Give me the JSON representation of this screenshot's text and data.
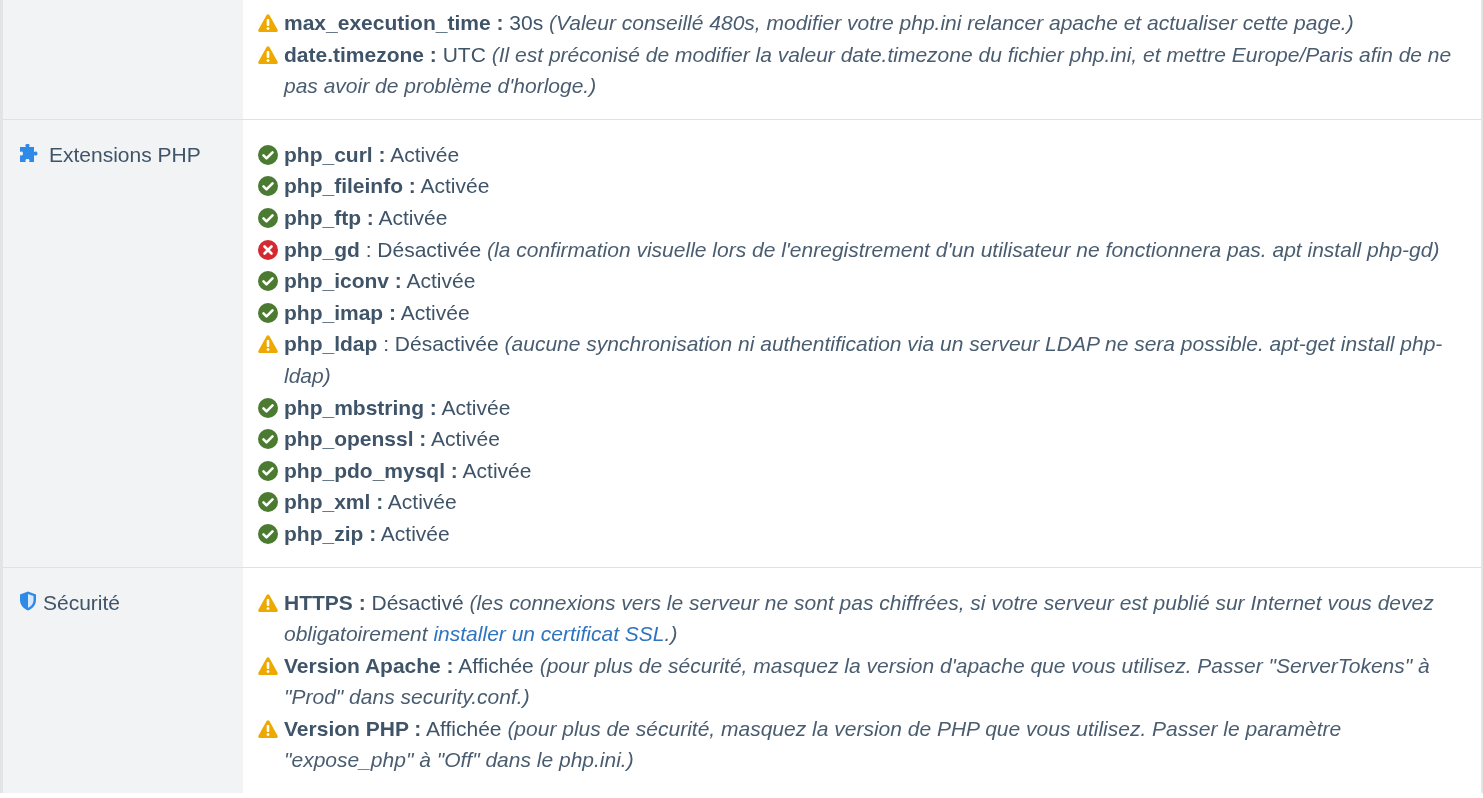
{
  "rows": [
    {
      "items": [
        {
          "kind": "warning",
          "text": "**max_execution_time :** 30s",
          "note": "(Valeur conseillé 480s, modifier votre php.ini relancer apache et actualiser cette page.)"
        },
        {
          "kind": "warning",
          "text": "**date.timezone :** UTC",
          "note": "(Il est préconisé de modifier la valeur date.timezone du fichier php.ini, et mettre Europe/Paris afin de ne pas avoir de problème d'horloge.)"
        }
      ]
    },
    {
      "label": "Extensions PHP",
      "kind": "puzzle",
      "items": [
        {
          "kind": "ok",
          "text": "**php_curl :** Activée"
        },
        {
          "kind": "ok",
          "text": "**php_fileinfo :** Activée"
        },
        {
          "kind": "ok",
          "text": "**php_ftp :** Activée"
        },
        {
          "kind": "error",
          "text": "**php_gd** : Désactivée",
          "note": "(la confirmation visuelle lors de l'enregistrement d'un utilisateur ne fonctionnera pas. apt install php-gd)"
        },
        {
          "kind": "ok",
          "text": "**php_iconv :** Activée"
        },
        {
          "kind": "ok",
          "text": "**php_imap :** Activée"
        },
        {
          "kind": "warning",
          "text": "**php_ldap** : Désactivée",
          "note": "(aucune synchronisation ni authentification via un serveur LDAP ne sera possible. apt-get install php-ldap)"
        },
        {
          "kind": "ok",
          "text": "**php_mbstring :** Activée"
        },
        {
          "kind": "ok",
          "text": "**php_openssl :** Activée"
        },
        {
          "kind": "ok",
          "text": "**php_pdo_mysql :** Activée"
        },
        {
          "kind": "ok",
          "text": "**php_xml :** Activée"
        },
        {
          "kind": "ok",
          "text": "**php_zip :** Activée"
        }
      ]
    },
    {
      "label": "Sécurité",
      "kind": "shield",
      "items": [
        {
          "kind": "warning",
          "text": "**HTTPS :** Désactivé",
          "note": "(les connexions vers le serveur ne sont pas chiffrées, si votre serveur est publié sur Internet vous devez obligatoirement",
          "link": "installer un certificat SSL",
          "note_after": ".)"
        },
        {
          "kind": "warning",
          "text": "**Version Apache :** Affichée",
          "note": "(pour plus de sécurité, masquez la version d'apache que vous utilisez. Passer \"ServerTokens\" à \"Prod\" dans security.conf.)"
        },
        {
          "kind": "warning",
          "text": "**Version PHP :** Affichée",
          "note": "(pour plus de sécurité, masquez la version de PHP que vous utilisez. Passer le paramètre \"expose_php\" à \"Off\" dans le php.ini.)"
        }
      ]
    }
  ]
}
